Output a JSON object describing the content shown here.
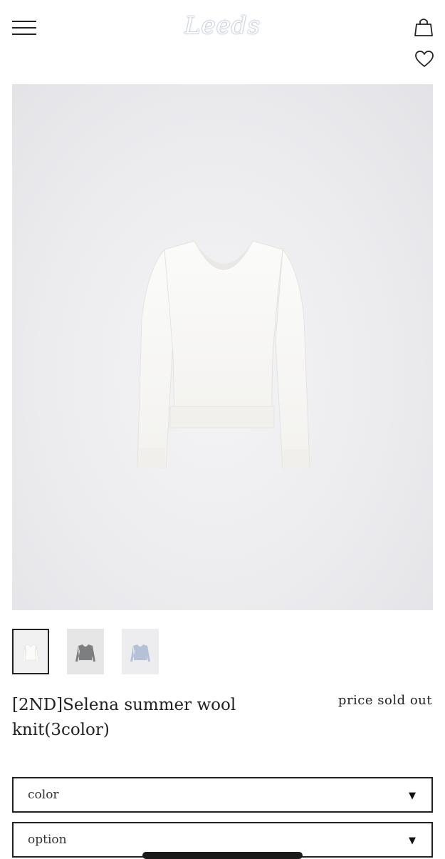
{
  "header": {
    "logo": "Leeds",
    "menu_icon": "hamburger-menu-icon",
    "cart_icon": "shopping-bag-icon",
    "wishlist_icon": "heart-icon"
  },
  "product": {
    "name": "[2ND]Selena summer wool knit(3color)",
    "price": "price sold out",
    "thumbnails": [
      "ivory-knit-thumbnail",
      "grey-knit-thumbnail",
      "light-blue-knit-thumbnail"
    ]
  },
  "options": {
    "color_label": "color",
    "option_label": "option",
    "arrow": "▼"
  },
  "colors": {
    "text": "#222222",
    "background": "#ffffff",
    "logo_outline": "#8a97ad"
  }
}
